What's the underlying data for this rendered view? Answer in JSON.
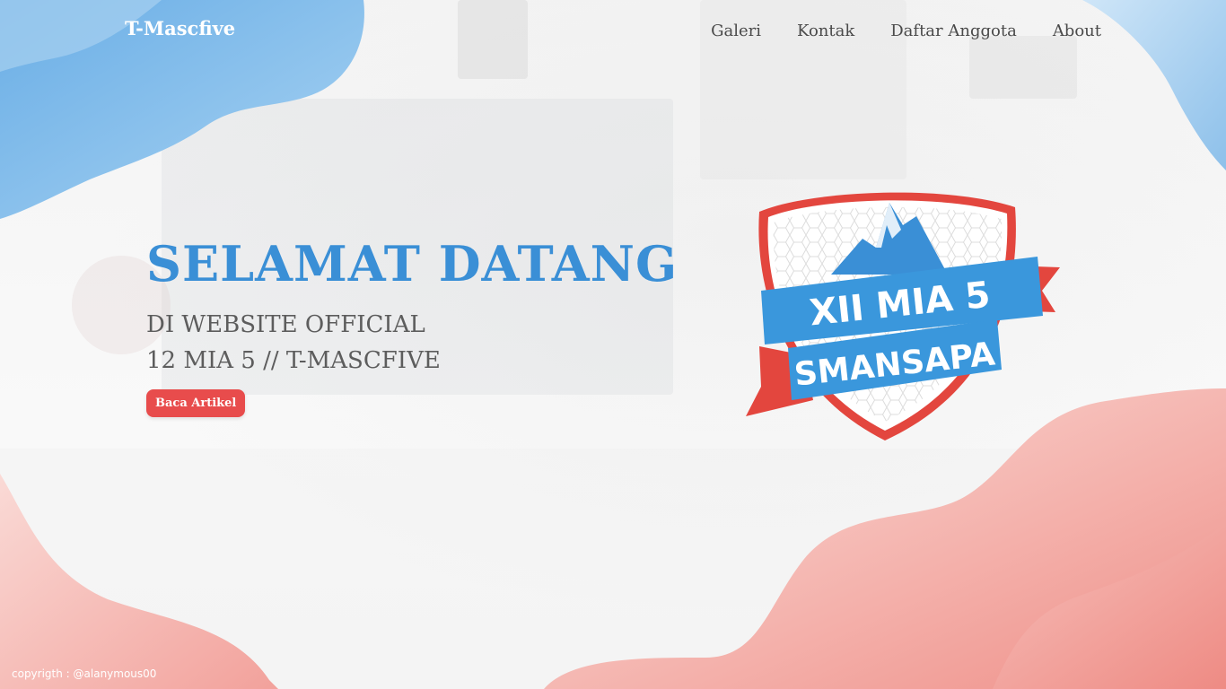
{
  "header": {
    "logo": "T-Mascfive",
    "nav": [
      {
        "label": "Galeri"
      },
      {
        "label": "Kontak"
      },
      {
        "label": "Daftar Anggota"
      },
      {
        "label": "About"
      }
    ]
  },
  "hero": {
    "title": "SELAMAT DATANG",
    "subtitle_line1": "DI WEBSITE OFFICIAL",
    "subtitle_line2": "12 MIA 5 // T-MASCFIVE",
    "button_label": "Baca Artikel"
  },
  "badge": {
    "line1": "XII MIA 5",
    "line2": "SMANSAPA"
  },
  "footer": {
    "copyright": "copyrigth : @alanymous00"
  },
  "colors": {
    "accent_blue": "#3a8fd6",
    "accent_red": "#e84c4c",
    "blob_blue": "#8fc2ea",
    "blob_red": "#f2a19b"
  }
}
